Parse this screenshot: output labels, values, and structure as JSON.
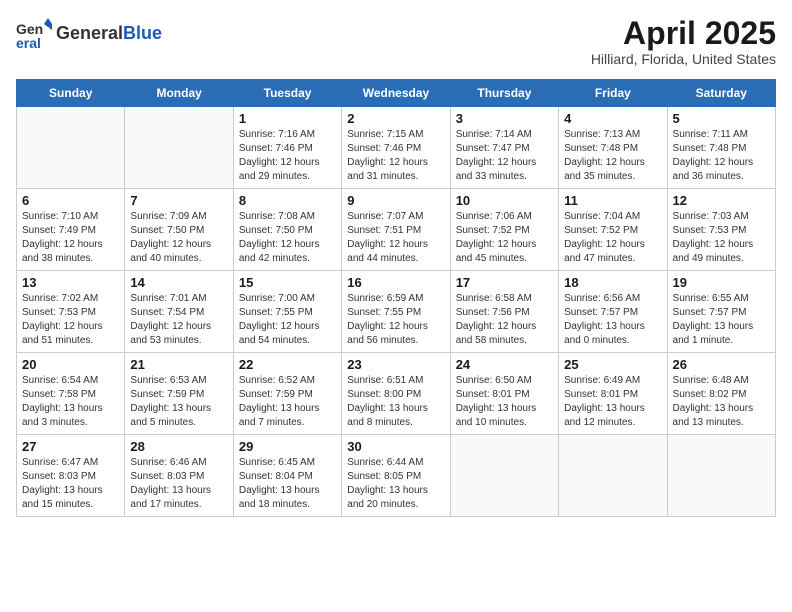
{
  "header": {
    "logo_general": "General",
    "logo_blue": "Blue",
    "month_title": "April 2025",
    "location": "Hilliard, Florida, United States"
  },
  "days_of_week": [
    "Sunday",
    "Monday",
    "Tuesday",
    "Wednesday",
    "Thursday",
    "Friday",
    "Saturday"
  ],
  "weeks": [
    [
      {
        "day": "",
        "content": ""
      },
      {
        "day": "",
        "content": ""
      },
      {
        "day": "1",
        "content": "Sunrise: 7:16 AM\nSunset: 7:46 PM\nDaylight: 12 hours and 29 minutes."
      },
      {
        "day": "2",
        "content": "Sunrise: 7:15 AM\nSunset: 7:46 PM\nDaylight: 12 hours and 31 minutes."
      },
      {
        "day": "3",
        "content": "Sunrise: 7:14 AM\nSunset: 7:47 PM\nDaylight: 12 hours and 33 minutes."
      },
      {
        "day": "4",
        "content": "Sunrise: 7:13 AM\nSunset: 7:48 PM\nDaylight: 12 hours and 35 minutes."
      },
      {
        "day": "5",
        "content": "Sunrise: 7:11 AM\nSunset: 7:48 PM\nDaylight: 12 hours and 36 minutes."
      }
    ],
    [
      {
        "day": "6",
        "content": "Sunrise: 7:10 AM\nSunset: 7:49 PM\nDaylight: 12 hours and 38 minutes."
      },
      {
        "day": "7",
        "content": "Sunrise: 7:09 AM\nSunset: 7:50 PM\nDaylight: 12 hours and 40 minutes."
      },
      {
        "day": "8",
        "content": "Sunrise: 7:08 AM\nSunset: 7:50 PM\nDaylight: 12 hours and 42 minutes."
      },
      {
        "day": "9",
        "content": "Sunrise: 7:07 AM\nSunset: 7:51 PM\nDaylight: 12 hours and 44 minutes."
      },
      {
        "day": "10",
        "content": "Sunrise: 7:06 AM\nSunset: 7:52 PM\nDaylight: 12 hours and 45 minutes."
      },
      {
        "day": "11",
        "content": "Sunrise: 7:04 AM\nSunset: 7:52 PM\nDaylight: 12 hours and 47 minutes."
      },
      {
        "day": "12",
        "content": "Sunrise: 7:03 AM\nSunset: 7:53 PM\nDaylight: 12 hours and 49 minutes."
      }
    ],
    [
      {
        "day": "13",
        "content": "Sunrise: 7:02 AM\nSunset: 7:53 PM\nDaylight: 12 hours and 51 minutes."
      },
      {
        "day": "14",
        "content": "Sunrise: 7:01 AM\nSunset: 7:54 PM\nDaylight: 12 hours and 53 minutes."
      },
      {
        "day": "15",
        "content": "Sunrise: 7:00 AM\nSunset: 7:55 PM\nDaylight: 12 hours and 54 minutes."
      },
      {
        "day": "16",
        "content": "Sunrise: 6:59 AM\nSunset: 7:55 PM\nDaylight: 12 hours and 56 minutes."
      },
      {
        "day": "17",
        "content": "Sunrise: 6:58 AM\nSunset: 7:56 PM\nDaylight: 12 hours and 58 minutes."
      },
      {
        "day": "18",
        "content": "Sunrise: 6:56 AM\nSunset: 7:57 PM\nDaylight: 13 hours and 0 minutes."
      },
      {
        "day": "19",
        "content": "Sunrise: 6:55 AM\nSunset: 7:57 PM\nDaylight: 13 hours and 1 minute."
      }
    ],
    [
      {
        "day": "20",
        "content": "Sunrise: 6:54 AM\nSunset: 7:58 PM\nDaylight: 13 hours and 3 minutes."
      },
      {
        "day": "21",
        "content": "Sunrise: 6:53 AM\nSunset: 7:59 PM\nDaylight: 13 hours and 5 minutes."
      },
      {
        "day": "22",
        "content": "Sunrise: 6:52 AM\nSunset: 7:59 PM\nDaylight: 13 hours and 7 minutes."
      },
      {
        "day": "23",
        "content": "Sunrise: 6:51 AM\nSunset: 8:00 PM\nDaylight: 13 hours and 8 minutes."
      },
      {
        "day": "24",
        "content": "Sunrise: 6:50 AM\nSunset: 8:01 PM\nDaylight: 13 hours and 10 minutes."
      },
      {
        "day": "25",
        "content": "Sunrise: 6:49 AM\nSunset: 8:01 PM\nDaylight: 13 hours and 12 minutes."
      },
      {
        "day": "26",
        "content": "Sunrise: 6:48 AM\nSunset: 8:02 PM\nDaylight: 13 hours and 13 minutes."
      }
    ],
    [
      {
        "day": "27",
        "content": "Sunrise: 6:47 AM\nSunset: 8:03 PM\nDaylight: 13 hours and 15 minutes."
      },
      {
        "day": "28",
        "content": "Sunrise: 6:46 AM\nSunset: 8:03 PM\nDaylight: 13 hours and 17 minutes."
      },
      {
        "day": "29",
        "content": "Sunrise: 6:45 AM\nSunset: 8:04 PM\nDaylight: 13 hours and 18 minutes."
      },
      {
        "day": "30",
        "content": "Sunrise: 6:44 AM\nSunset: 8:05 PM\nDaylight: 13 hours and 20 minutes."
      },
      {
        "day": "",
        "content": ""
      },
      {
        "day": "",
        "content": ""
      },
      {
        "day": "",
        "content": ""
      }
    ]
  ]
}
